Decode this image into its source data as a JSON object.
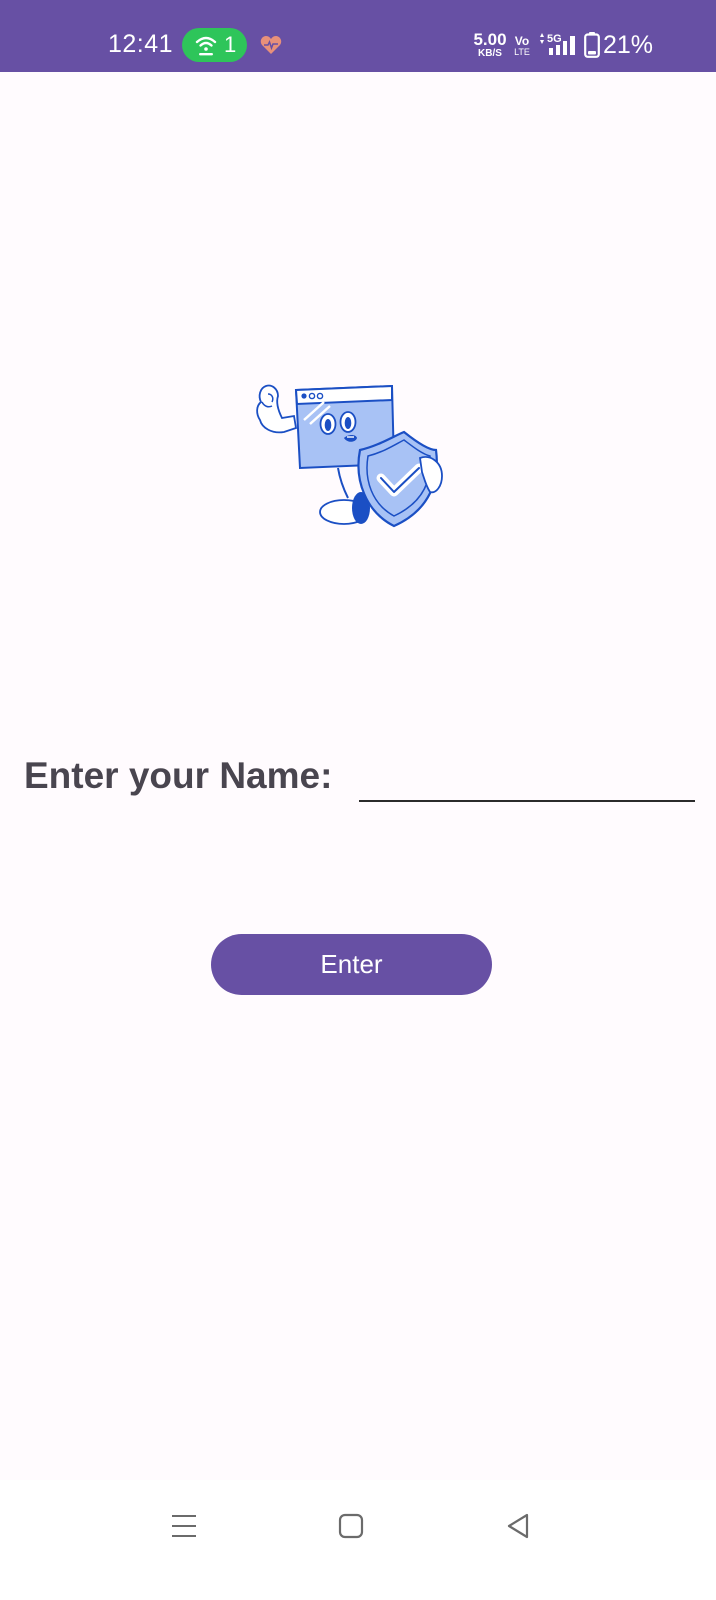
{
  "status_bar": {
    "time": "12:41",
    "hotspot_count": "1",
    "net_speed_value": "5.00",
    "net_speed_unit": "KB/S",
    "volte_top": "Vo",
    "volte_bottom": "LTE",
    "network_type": "5G",
    "battery_percent": "21%",
    "background_color": "#6750a4",
    "hotspot_color": "#2ec55a",
    "icons": [
      "hotspot-icon",
      "heart-icon",
      "signal-icon",
      "battery-icon"
    ]
  },
  "main": {
    "illustration_icon": "shield-mascot-illustration",
    "name_label": "Enter your Name:",
    "name_input_value": "",
    "name_input_placeholder": "",
    "enter_button_label": "Enter",
    "accent_color": "#6750a4",
    "label_color": "#49454f"
  },
  "nav_bar": {
    "buttons": [
      "menu-icon",
      "home-icon",
      "back-icon"
    ]
  }
}
